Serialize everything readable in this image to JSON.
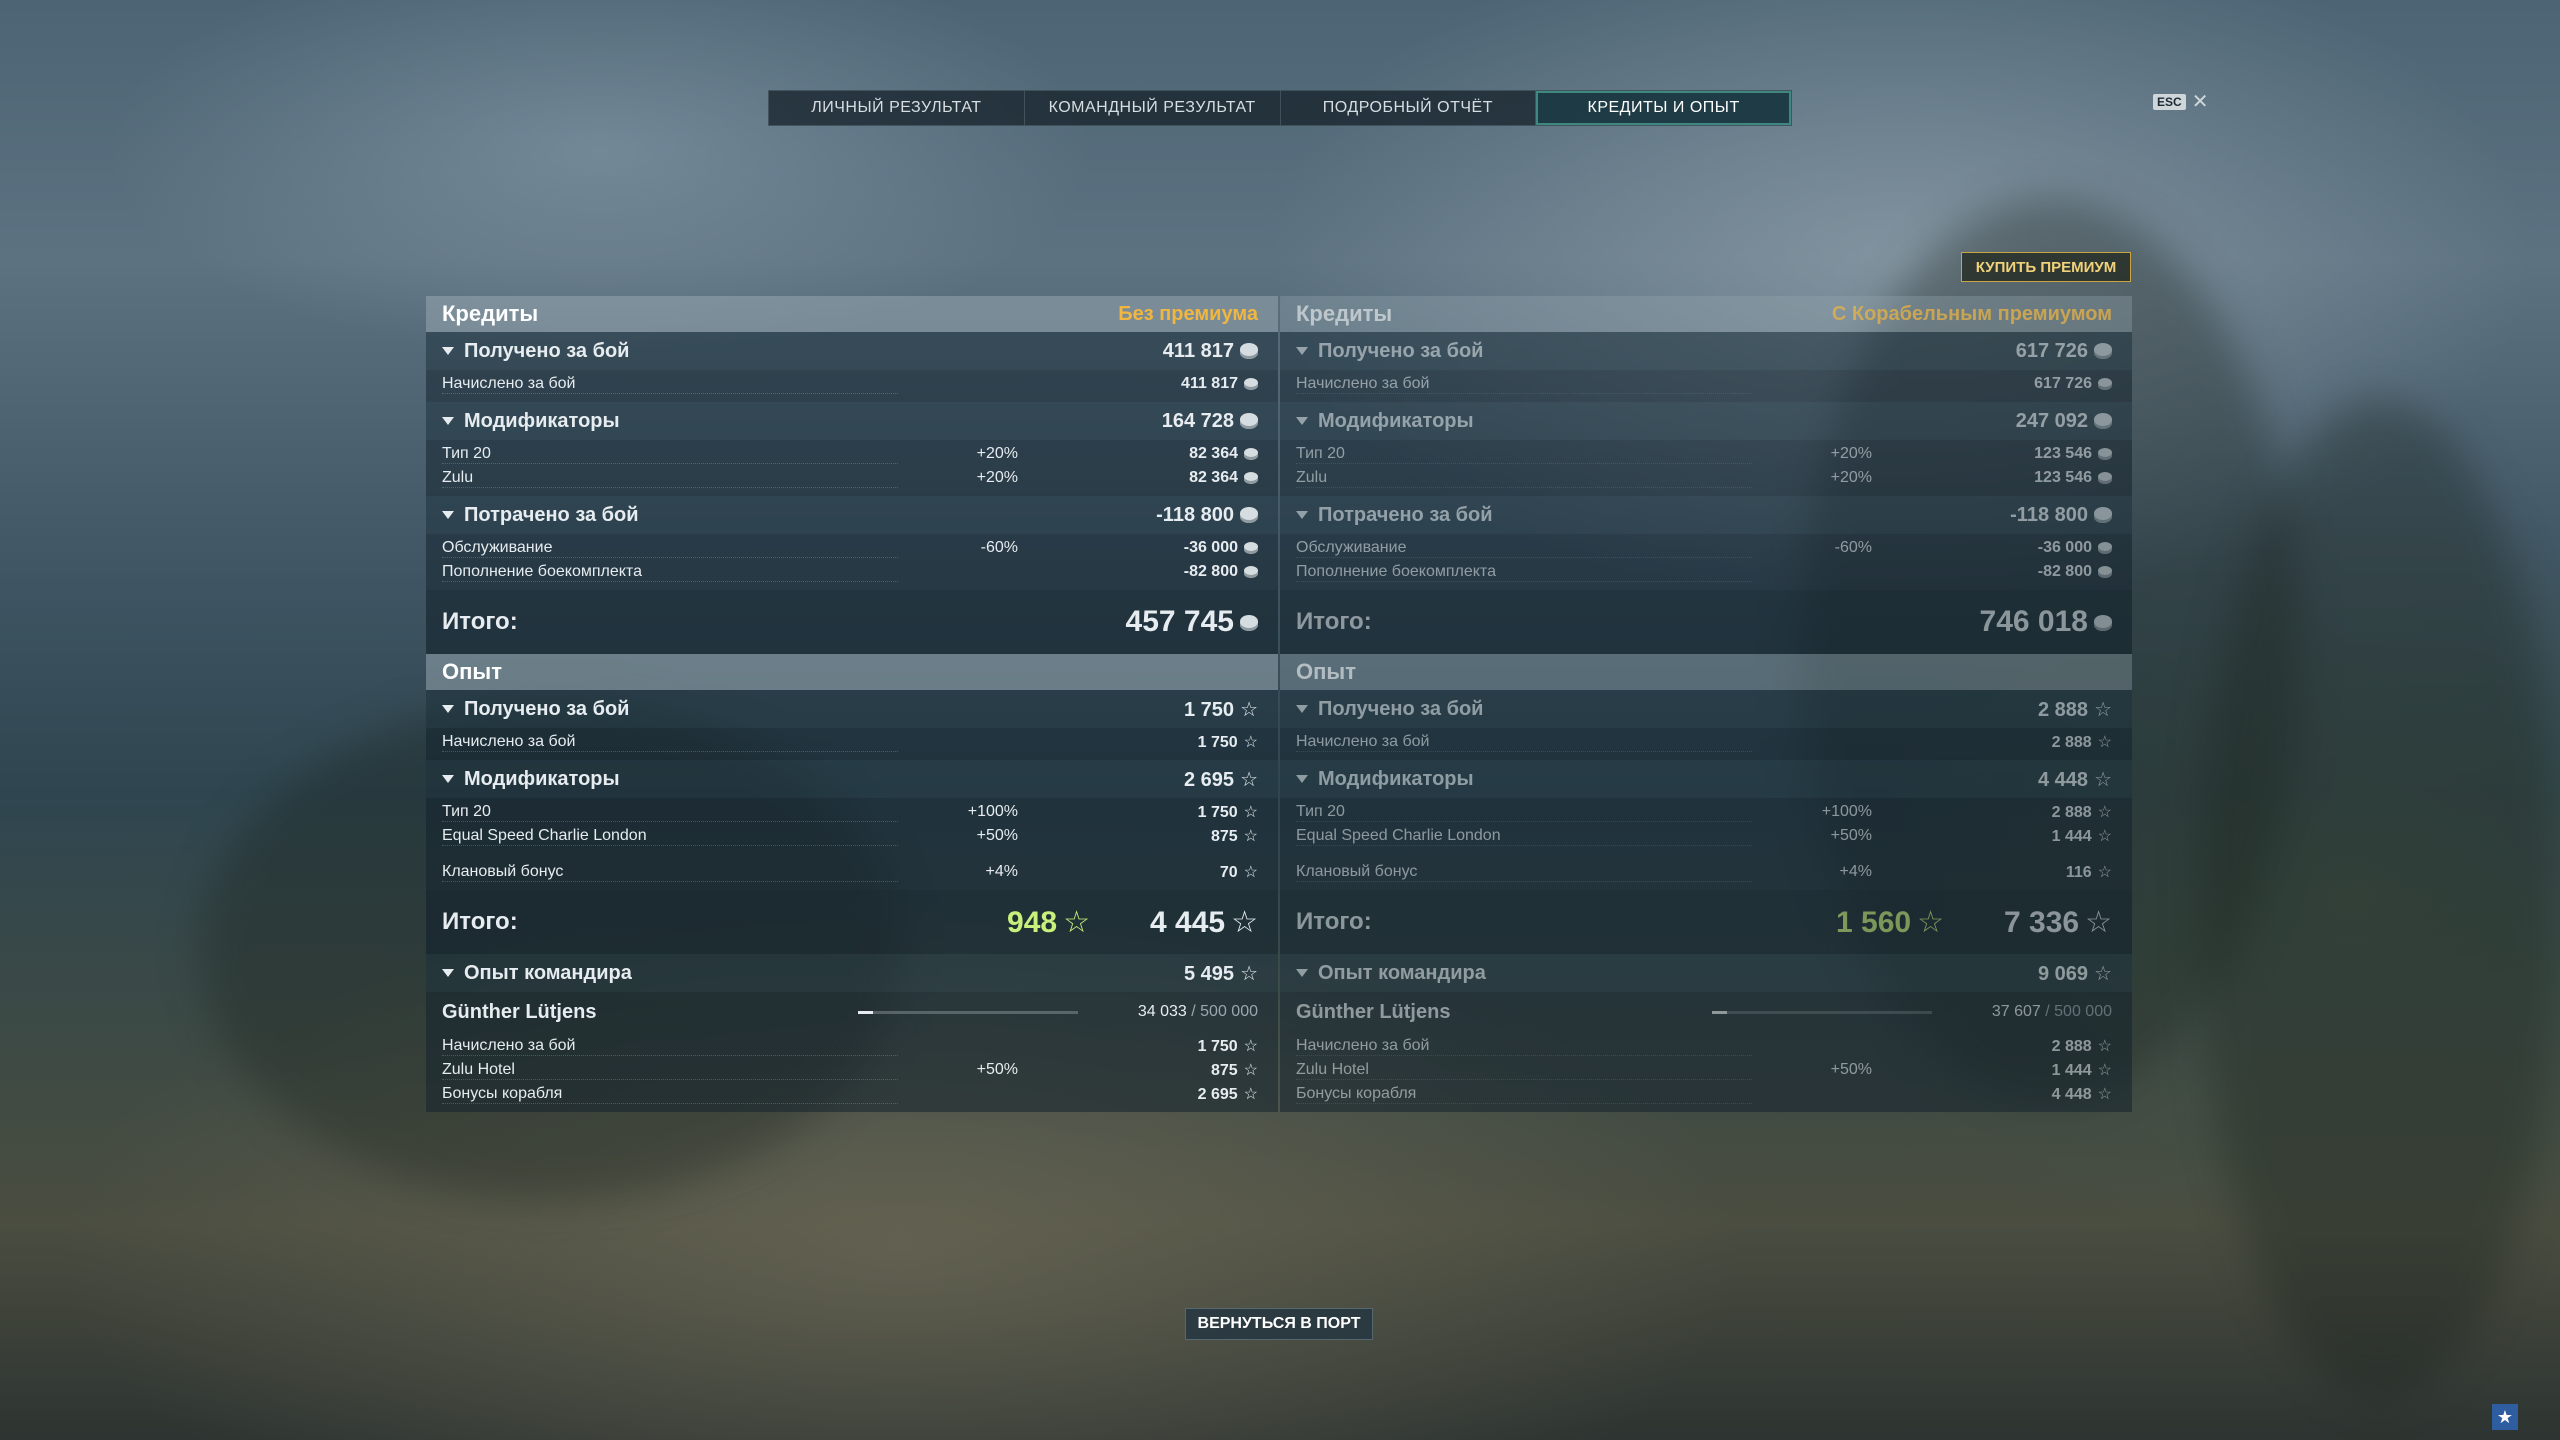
{
  "tabs": [
    {
      "label": "ЛИЧНЫЙ РЕЗУЛЬТАТ"
    },
    {
      "label": "КОМАНДНЫЙ РЕЗУЛЬТАТ"
    },
    {
      "label": "ПОДРОБНЫЙ ОТЧЁТ"
    },
    {
      "label": "КРЕДИТЫ И ОПЫТ"
    }
  ],
  "esc": {
    "key": "ESC",
    "close": "✕"
  },
  "buy_premium": "КУПИТЬ ПРЕМИУМ",
  "back_button": "ВЕРНУТЬСЯ В ПОРТ",
  "corner_icon": "★",
  "left": {
    "credits": {
      "title": "Кредиты",
      "badge": "Без премиума",
      "earned": {
        "label": "Получено за бой",
        "value": "411 817"
      },
      "earned_rows": [
        {
          "label": "Начислено за бой",
          "pct": "",
          "value": "411 817"
        }
      ],
      "mods": {
        "label": "Модификаторы",
        "value": "164 728"
      },
      "mods_rows": [
        {
          "label": "Тип 20",
          "pct": "+20%",
          "value": "82 364"
        },
        {
          "label": "Zulu",
          "pct": "+20%",
          "value": "82 364"
        }
      ],
      "spent": {
        "label": "Потрачено за бой",
        "value": "-118 800"
      },
      "spent_rows": [
        {
          "label": "Обслуживание",
          "pct": "-60%",
          "value": "-36 000"
        },
        {
          "label": "Пополнение боекомплекта",
          "pct": "",
          "value": "-82 800"
        }
      ],
      "total_label": "Итого:",
      "total_value": "457 745"
    },
    "xp": {
      "title": "Опыт",
      "earned": {
        "label": "Получено за бой",
        "value": "1 750"
      },
      "earned_rows": [
        {
          "label": "Начислено за бой",
          "pct": "",
          "value": "1 750"
        }
      ],
      "mods": {
        "label": "Модификаторы",
        "value": "2 695"
      },
      "mods_rows": [
        {
          "label": "Тип 20",
          "pct": "+100%",
          "value": "1 750"
        },
        {
          "label": "Equal Speed Charlie London",
          "pct": "+50%",
          "value": "875"
        },
        {
          "label": "Клановый бонус",
          "pct": "+4%",
          "value": "70"
        }
      ],
      "total_label": "Итого:",
      "total_free": "948",
      "total_value": "4 445",
      "cmd": {
        "label": "Опыт командира",
        "value": "5 495"
      },
      "commander": {
        "name": "Günther Lütjens",
        "progress": "34 033",
        "max": "/ 500 000"
      },
      "cmd_rows": [
        {
          "label": "Начислено за бой",
          "pct": "",
          "value": "1 750"
        },
        {
          "label": "Zulu Hotel",
          "pct": "+50%",
          "value": "875"
        },
        {
          "label": "Бонусы корабля",
          "pct": "",
          "value": "2 695"
        }
      ]
    }
  },
  "right": {
    "credits": {
      "title": "Кредиты",
      "badge": "С Корабельным премиумом",
      "earned": {
        "label": "Получено за бой",
        "value": "617 726"
      },
      "earned_rows": [
        {
          "label": "Начислено за бой",
          "pct": "",
          "value": "617 726"
        }
      ],
      "mods": {
        "label": "Модификаторы",
        "value": "247 092"
      },
      "mods_rows": [
        {
          "label": "Тип 20",
          "pct": "+20%",
          "value": "123 546"
        },
        {
          "label": "Zulu",
          "pct": "+20%",
          "value": "123 546"
        }
      ],
      "spent": {
        "label": "Потрачено за бой",
        "value": "-118 800"
      },
      "spent_rows": [
        {
          "label": "Обслуживание",
          "pct": "-60%",
          "value": "-36 000"
        },
        {
          "label": "Пополнение боекомплекта",
          "pct": "",
          "value": "-82 800"
        }
      ],
      "total_label": "Итого:",
      "total_value": "746 018"
    },
    "xp": {
      "title": "Опыт",
      "earned": {
        "label": "Получено за бой",
        "value": "2 888"
      },
      "earned_rows": [
        {
          "label": "Начислено за бой",
          "pct": "",
          "value": "2 888"
        }
      ],
      "mods": {
        "label": "Модификаторы",
        "value": "4 448"
      },
      "mods_rows": [
        {
          "label": "Тип 20",
          "pct": "+100%",
          "value": "2 888"
        },
        {
          "label": "Equal Speed Charlie London",
          "pct": "+50%",
          "value": "1 444"
        },
        {
          "label": "Клановый бонус",
          "pct": "+4%",
          "value": "116"
        }
      ],
      "total_label": "Итого:",
      "total_free": "1 560",
      "total_value": "7 336",
      "cmd": {
        "label": "Опыт командира",
        "value": "9 069"
      },
      "commander": {
        "name": "Günther Lütjens",
        "progress": "37 607",
        "max": "/ 500 000"
      },
      "cmd_rows": [
        {
          "label": "Начислено за бой",
          "pct": "",
          "value": "2 888"
        },
        {
          "label": "Zulu Hotel",
          "pct": "+50%",
          "value": "1 444"
        },
        {
          "label": "Бонусы корабля",
          "pct": "",
          "value": "4 448"
        }
      ]
    }
  }
}
